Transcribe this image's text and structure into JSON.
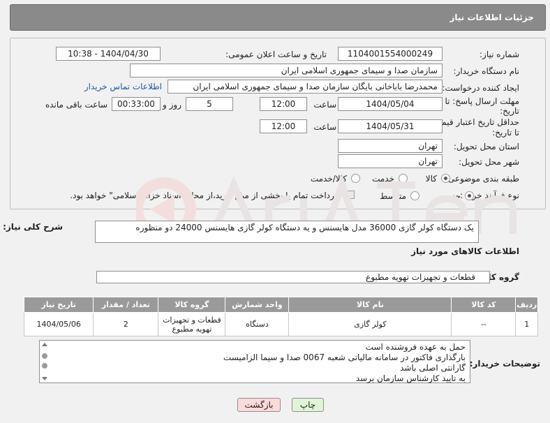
{
  "header": {
    "title": "جزئیات اطلاعات نیاز"
  },
  "fields": {
    "need_number_label": "شماره نیاز:",
    "need_number": "1104001554000249",
    "announce_label": "تاریخ و ساعت اعلان عمومی:",
    "announce_value": "1404/04/30 - 10:38",
    "buyer_org_label": "نام دستگاه خریدار:",
    "buyer_org": "سازمان صدا و سیمای جمهوری اسلامی ایران",
    "creator_label": "ایجاد کننده درخواست:",
    "creator": "محمدرضا  باباخانی بایگان سازمان صدا و سیمای جمهوری اسلامی ایران",
    "contact_link": "اطلاعات تماس خریدار",
    "deadline_label_1": "مهلت ارسال پاسخ: تا",
    "deadline_label_2": "تاریخ:",
    "deadline_date": "1404/05/04",
    "time_label": "ساعت",
    "deadline_time": "12:00",
    "days_value": "5",
    "days_label": "روز و",
    "remaining_time": "00:33:00",
    "remaining_label": "ساعت باقی مانده",
    "validity_label_1": "حداقل تاریخ اعتبار قیمت:",
    "validity_label_2": "تا تاریخ:",
    "validity_date": "1404/05/31",
    "validity_time": "12:00",
    "province_label": "استان محل تحویل:",
    "province": "تهران",
    "city_label": "شهر محل تحویل:",
    "city": "تهران",
    "category_label": "طبقه بندی موضوعی:",
    "category_options": [
      "کالا",
      "خدمت",
      "کالا/خدمت"
    ],
    "category_selected": 0,
    "process_label": "نوع فرآیند خرید :",
    "process_options": [
      "جزیی",
      "متوسط"
    ],
    "process_selected": 0,
    "payment_note": "پرداخت تمام یا بخشی از مبلغ خرید،از محل \"اسناد خزانه اسلامی\" خواهد بود."
  },
  "description": {
    "label": "شرح کلی نیاز:",
    "text": "یک دستگاه کولر گازی 36000 مدل هایسنس و یه دستگاه کولر گازی هایسنس 24000  دو منظوره"
  },
  "goods": {
    "section_title": "اطلاعات کالاهای مورد نیاز",
    "group_label": "گروه کالا:",
    "group_value": "قطعات و تجهیزات تهویه مطبوع",
    "columns": [
      "ردیف",
      "کد کالا",
      "نام کالا",
      "واحد شمارش",
      "گروه کالا",
      "تعداد / مقدار",
      "تاریخ نیاز"
    ],
    "rows": [
      [
        "1",
        "--",
        "کولر گازی",
        "دستگاه",
        "قطعات و تجهیزات تهویه مطبوع",
        "2",
        "1404/05/06"
      ]
    ]
  },
  "buyer_notes": {
    "label": "توضیحات خریدار:",
    "lines": [
      "حمل به عهده فروشنده است",
      "بارگذاری فاکتور در سامانه مالیاتی شعبه 0067 صدا و سیما الزامیست",
      "گارانتی اصلی باشد",
      "به تایید کارشناس سازمان برسد"
    ]
  },
  "buttons": {
    "print": "چاپ",
    "back": "بازگشت"
  },
  "colors": {
    "header_bg": "#8a8a8a",
    "print_bg": "#dff5d6",
    "back_bg": "#fbdada",
    "link": "#1a5aa6"
  }
}
